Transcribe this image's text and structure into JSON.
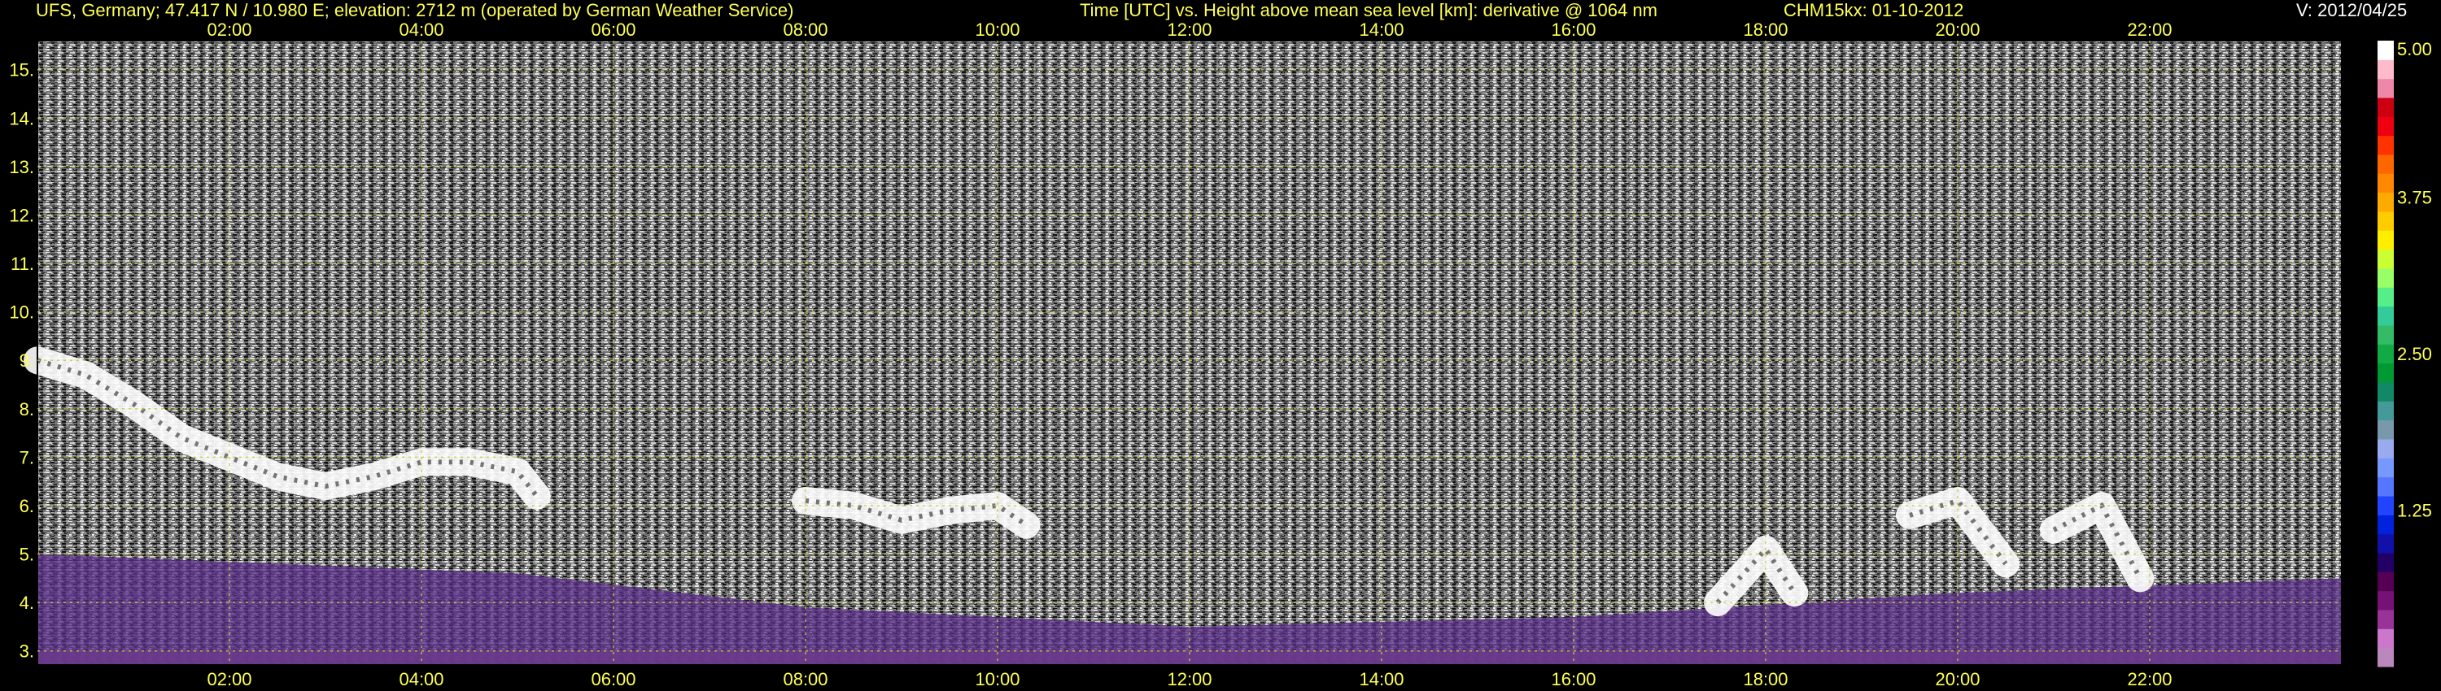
{
  "header": {
    "station": "UFS, Germany; 47.417 N / 10.980 E; elevation: 2712 m  (operated by German Weather Service)",
    "description": "Time [UTC] vs. Height above mean sea level [km]: derivative @ 1064 nm",
    "instrument_date": "CHM15kx: 01-10-2012",
    "version": "V: 2012/04/25"
  },
  "colors": {
    "background": "#000000",
    "label_text": "#ffff55",
    "header_right_text": "#ffffff",
    "grid": "#cccc33",
    "noise_light": "#d8d8d8",
    "noise_dark": "#1a1a1a",
    "aerosol_layer": "#5a2c8a",
    "cloud": "#ffffff"
  },
  "chart_data": {
    "type": "heatmap",
    "title": "",
    "xlabel": "",
    "ylabel": "",
    "x_unit": "hours UTC",
    "y_unit": "km",
    "x_range": [
      0.0,
      24.0
    ],
    "y_range": [
      2.71,
      15.6
    ],
    "x_ticks": [
      {
        "value": 2,
        "label": "02:00"
      },
      {
        "value": 4,
        "label": "04:00"
      },
      {
        "value": 6,
        "label": "06:00"
      },
      {
        "value": 8,
        "label": "08:00"
      },
      {
        "value": 10,
        "label": "10:00"
      },
      {
        "value": 12,
        "label": "12:00"
      },
      {
        "value": 14,
        "label": "14:00"
      },
      {
        "value": 16,
        "label": "16:00"
      },
      {
        "value": 18,
        "label": "18:00"
      },
      {
        "value": 20,
        "label": "20:00"
      },
      {
        "value": 22,
        "label": "22:00"
      }
    ],
    "y_ticks": [
      {
        "value": 3,
        "label": "3."
      },
      {
        "value": 4,
        "label": "4."
      },
      {
        "value": 5,
        "label": "5."
      },
      {
        "value": 6,
        "label": "6."
      },
      {
        "value": 7,
        "label": "7."
      },
      {
        "value": 8,
        "label": "8."
      },
      {
        "value": 9,
        "label": "9."
      },
      {
        "value": 10,
        "label": "10."
      },
      {
        "value": 11,
        "label": "11."
      },
      {
        "value": 12,
        "label": "12."
      },
      {
        "value": 13,
        "label": "13."
      },
      {
        "value": 14,
        "label": "14."
      },
      {
        "value": 15,
        "label": "15."
      }
    ],
    "grid": true,
    "colorbar": {
      "range": [
        0,
        5
      ],
      "ticks": [
        {
          "value": 1.25,
          "label": "1.25"
        },
        {
          "value": 2.5,
          "label": "2.50"
        },
        {
          "value": 3.75,
          "label": "3.75"
        },
        {
          "value": 5,
          "label": "5.00"
        }
      ],
      "colors": [
        "#bb88bb",
        "#cc77cc",
        "#993399",
        "#771177",
        "#550055",
        "#220066",
        "#1111aa",
        "#0022dd",
        "#2244ff",
        "#5577ff",
        "#7799ff",
        "#99aaee",
        "#7799aa",
        "#449999",
        "#118866",
        "#009933",
        "#11aa44",
        "#33bb66",
        "#33cc99",
        "#55ee88",
        "#99ff66",
        "#ccff33",
        "#ffee00",
        "#ffcc00",
        "#ffaa00",
        "#ff8800",
        "#ff6600",
        "#ff3300",
        "#ee0011",
        "#cc0011",
        "#ee88aa",
        "#ffbbcc",
        "#ffffff"
      ]
    },
    "features": [
      {
        "name": "cloud",
        "points": [
          [
            0.0,
            9.0
          ],
          [
            0.5,
            8.7
          ],
          [
            1.0,
            8.1
          ],
          [
            1.5,
            7.4
          ],
          [
            2.0,
            7.0
          ],
          [
            2.5,
            6.6
          ],
          [
            3.0,
            6.4
          ],
          [
            3.5,
            6.6
          ],
          [
            4.0,
            6.9
          ],
          [
            4.5,
            6.9
          ],
          [
            5.0,
            6.7
          ],
          [
            5.2,
            6.2
          ]
        ]
      },
      {
        "name": "cloud",
        "points": [
          [
            8.0,
            6.1
          ],
          [
            8.5,
            6.0
          ],
          [
            9.0,
            5.7
          ],
          [
            9.5,
            5.9
          ],
          [
            10.0,
            6.0
          ],
          [
            10.3,
            5.6
          ]
        ]
      },
      {
        "name": "cloud",
        "points": [
          [
            17.5,
            4.0
          ],
          [
            18.0,
            5.1
          ],
          [
            18.3,
            4.2
          ]
        ]
      },
      {
        "name": "cloud",
        "points": [
          [
            19.5,
            5.8
          ],
          [
            20.0,
            6.1
          ],
          [
            20.5,
            4.8
          ]
        ]
      },
      {
        "name": "cloud",
        "points": [
          [
            21.0,
            5.5
          ],
          [
            21.5,
            6.0
          ],
          [
            21.9,
            4.5
          ]
        ]
      },
      {
        "name": "aerosol-layer",
        "points": [
          [
            0.0,
            5.0
          ],
          [
            5.0,
            4.6
          ],
          [
            8.0,
            3.9
          ],
          [
            12.0,
            3.5
          ],
          [
            16.0,
            3.7
          ],
          [
            20.0,
            4.2
          ],
          [
            24.0,
            4.5
          ]
        ]
      }
    ]
  }
}
